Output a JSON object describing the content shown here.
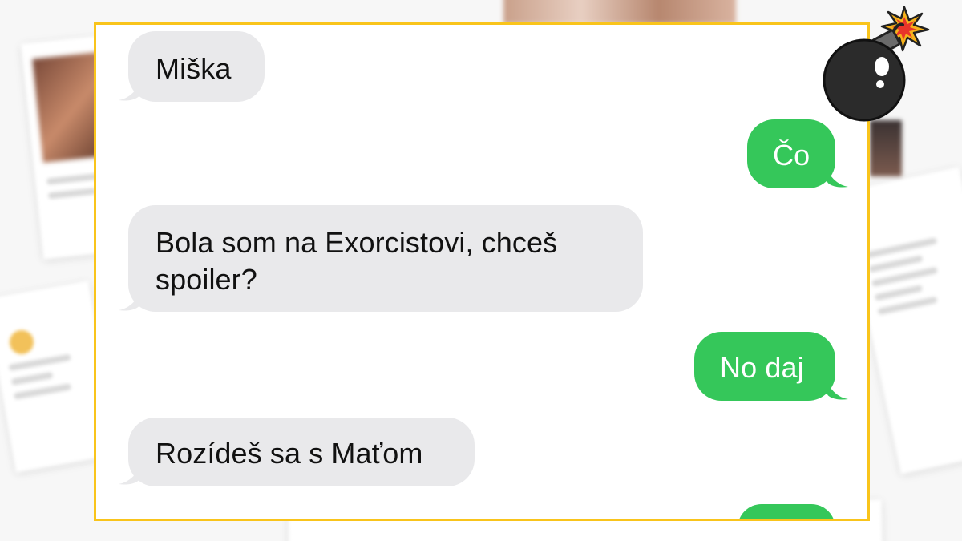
{
  "messages": [
    {
      "side": "incoming",
      "text": "Miška"
    },
    {
      "side": "outgoing",
      "text": "Čo"
    },
    {
      "side": "incoming",
      "line1": "Bola som na Exorcistovi, chceš",
      "line2": "spoiler?"
    },
    {
      "side": "outgoing",
      "text": "No daj"
    },
    {
      "side": "incoming",
      "text": "Rozídeš sa s Maťom"
    },
    {
      "side": "outgoing",
      "text": ""
    }
  ],
  "colors": {
    "frame_border": "#f9c41b",
    "incoming_bubble": "#e9e9eb",
    "outgoing_bubble": "#35c75a"
  },
  "icons": {
    "bomb": "bomb-icon"
  }
}
